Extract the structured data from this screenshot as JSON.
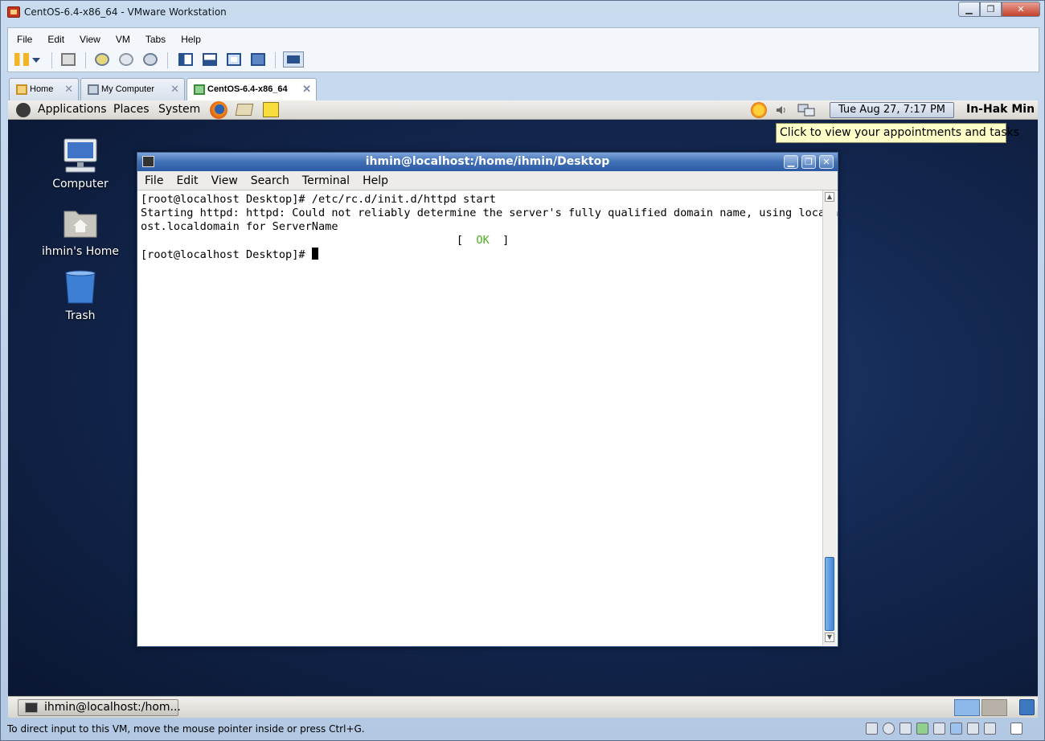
{
  "window": {
    "title": "CentOS-6.4-x86_64 - VMware Workstation",
    "min_icon": "minimize-icon",
    "max_icon": "maximize-icon",
    "close_icon": "close-icon",
    "close_glyph": "✕",
    "min_glyph": "▁",
    "max_glyph": "❐"
  },
  "menu": [
    "File",
    "Edit",
    "View",
    "VM",
    "Tabs",
    "Help"
  ],
  "toolbar": {
    "icons": [
      "pause-icon",
      "dropdown-arrow-icon",
      "network-icon",
      "snapshot-icon",
      "revert-snapshot-icon",
      "snapshot-manager-icon",
      "console-view-icon",
      "quick-switch-icon",
      "full-screen-icon",
      "unity-icon",
      "thumbnail-view-icon"
    ]
  },
  "tabs": [
    {
      "label": "Home",
      "icon": "home-icon",
      "active": false
    },
    {
      "label": "My Computer",
      "icon": "computer-icon",
      "active": false
    },
    {
      "label": "CentOS-6.4-x86_64",
      "icon": "vm-running-icon",
      "active": true
    }
  ],
  "tab_close_glyph": "✕",
  "guest": {
    "panel": {
      "menus": [
        "Applications",
        "Places",
        "System"
      ],
      "clock": "Tue Aug 27,  7:17 PM",
      "user": "In-Hak Min",
      "tooltip": "Click to view your appointments and tasks"
    },
    "desktop_icons": [
      {
        "label": "Computer",
        "icon": "computer-icon"
      },
      {
        "label": "ihmin's Home",
        "icon": "home-folder-icon"
      },
      {
        "label": "Trash",
        "icon": "trash-icon"
      }
    ],
    "terminal": {
      "title": "ihmin@localhost:/home/ihmin/Desktop",
      "menus": [
        "File",
        "Edit",
        "View",
        "Search",
        "Terminal",
        "Help"
      ],
      "lines": {
        "l1": "[root@localhost Desktop]# /etc/rc.d/init.d/httpd start",
        "l2": "Starting httpd: httpd: Could not reliably determine the server's fully qualified domain name, using localh",
        "l3": "ost.localdomain for ServerName",
        "l4_pre": "                                                [  ",
        "l4_ok": "OK",
        "l4_post": "  ]",
        "l5": "[root@localhost Desktop]# "
      },
      "scroll_up": "▲",
      "scroll_down": "▼"
    },
    "taskbar": {
      "item": "ihmin@localhost:/hom..."
    }
  },
  "statusbar": {
    "text": "To direct input to this VM, move the mouse pointer inside or press Ctrl+G.",
    "icons": [
      "hard-disk-icon",
      "cd-dvd-icon",
      "floppy-icon",
      "network-adapter-icon",
      "usb-icon",
      "sound-icon",
      "printer-icon",
      "display-icon",
      "message-icon"
    ]
  }
}
